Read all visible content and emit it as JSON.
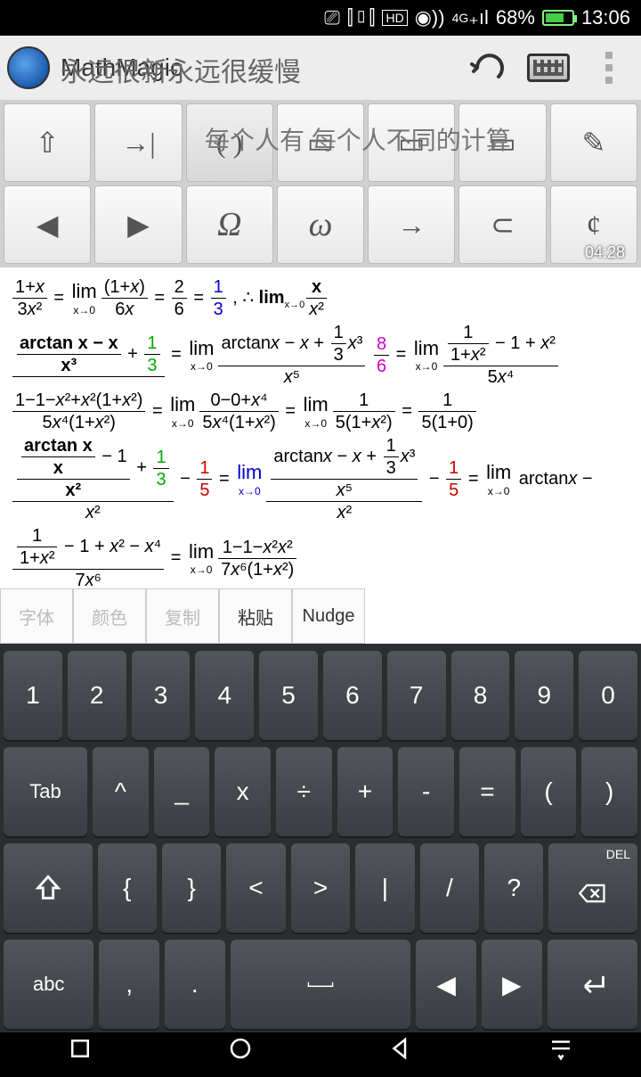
{
  "status": {
    "battery_pct": "68%",
    "time": "13:06",
    "net": "4G"
  },
  "titlebar": {
    "app_name": "MathMagic",
    "overlay": "永远很新永远很缓慢"
  },
  "toolbar": {
    "overlay": "每个人有 每个人不同的计算",
    "timestamp": "04:28",
    "row1": [
      "⇧",
      "→|",
      "( )",
      "▭",
      "▭",
      "▭",
      "✎"
    ],
    "row2": [
      "◀",
      "▶",
      "Ω",
      "ω",
      "→",
      "⊂",
      "¢"
    ]
  },
  "content_lines": [
    "(1+x)/3x² = lim[x→0] (1+x)/6x = 2/6 = 1/3 , ∴ lim[x→0] x/x²",
    "(arctan x − x)/x³ + 1/3 = lim[x→0] (arctan x − x + ⅓x³)/x⁵  8/6 = lim[x→0] (1/(1+x²) − 1 + x²)/5x⁴",
    "(1−1−x²+x²(1+x²))/5x⁴(1+x²) = lim[x→0] (0−0+x⁴)/5x⁴(1+x²) = lim[x→0] 1/5(1+x²) = 1/5(1+0)",
    "((arctan x/x − 1)/x² + 1/3)/x² − 1/5 = lim[x→0] ((arctan x − x + ⅓x³)/x⁵)/x² − 1/5 = lim[x→0] arctan x −",
    "(1/(1+x²) − 1 + x² − x⁴)/7x⁶ = lim[x→0] (1−1−x²x²)/7x⁶(1+x²)"
  ],
  "actions": {
    "font": "字体",
    "color": "颜色",
    "copy": "复制",
    "paste": "粘贴",
    "nudge": "Nudge"
  },
  "keyboard": {
    "r1": [
      "1",
      "2",
      "3",
      "4",
      "5",
      "6",
      "7",
      "8",
      "9",
      "0"
    ],
    "r2": [
      "Tab",
      "^",
      "_",
      "x",
      "÷",
      "+",
      "-",
      "=",
      "(",
      ")"
    ],
    "r3": [
      "⇧",
      "{",
      "}",
      "<",
      ">",
      "|",
      "/",
      "?",
      "DEL"
    ],
    "r4": [
      "abc",
      ",",
      ".",
      "space",
      "◀",
      "▶",
      "⏎"
    ]
  }
}
